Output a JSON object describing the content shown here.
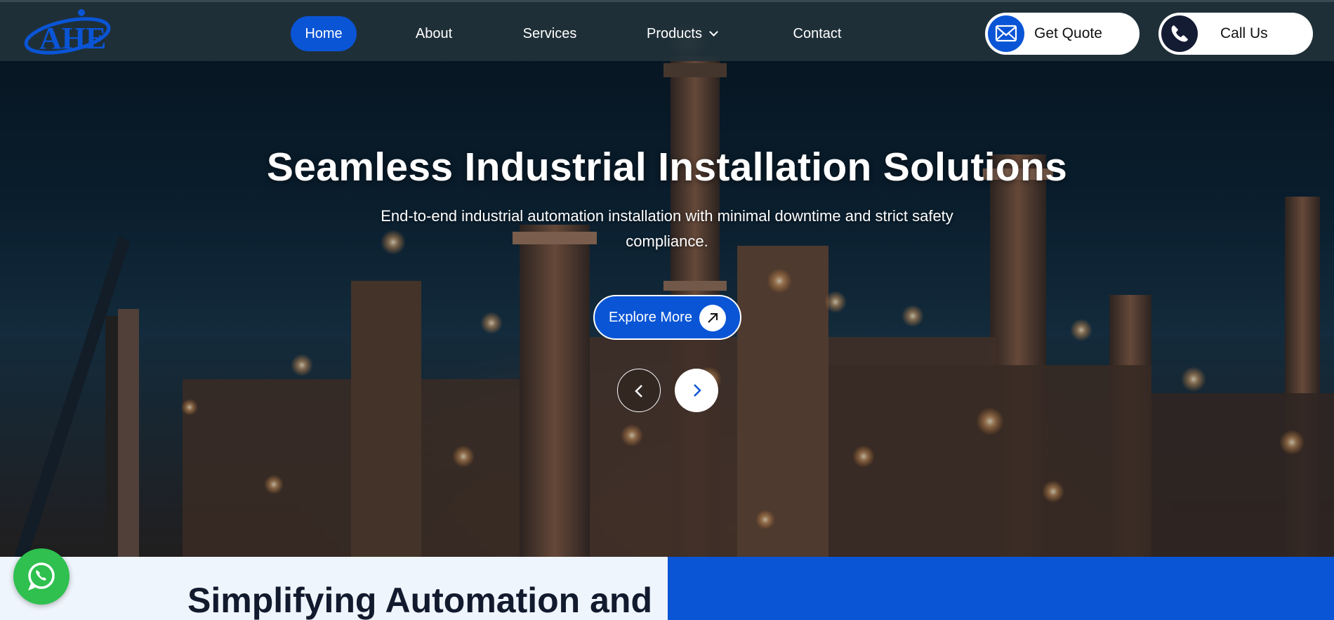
{
  "brand": {
    "logo_text": "AHE",
    "accent": "#0a55d6"
  },
  "nav": {
    "home": "Home",
    "about": "About",
    "services": "Services",
    "products": "Products",
    "contact": "Contact"
  },
  "actions": {
    "quote_label": "Get Quote",
    "call_label": "Call Us"
  },
  "hero": {
    "title": "Seamless Industrial Installation Solutions",
    "subtitle_line1": "End-to-end industrial automation installation with minimal downtime and strict safety",
    "subtitle_line2": "compliance.",
    "cta_label": "Explore More"
  },
  "section": {
    "heading": "Simplifying Automation and"
  },
  "icons": {
    "quote": "envelope-icon",
    "call": "phone-icon",
    "cta": "arrow-up-right-icon",
    "prev": "chevron-left-icon",
    "next": "chevron-right-icon",
    "chat": "whatsapp-icon"
  },
  "colors": {
    "nav_bg": "#21313a",
    "hero_overlay": "#0b2233",
    "section_left": "#eff5fc",
    "section_right": "#0a55d6",
    "whatsapp": "#2fc04f"
  }
}
